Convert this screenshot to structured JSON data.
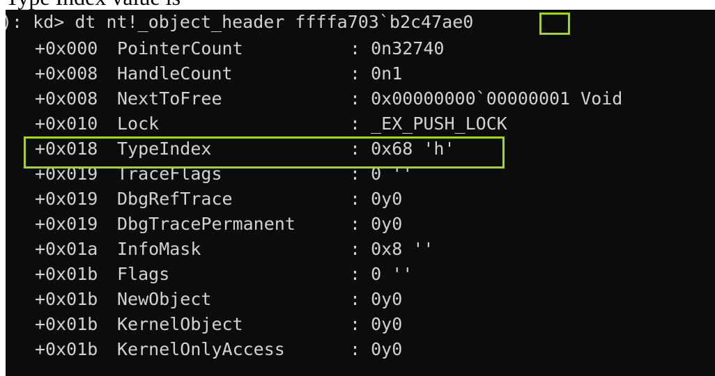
{
  "header_cutoff_text": "Type Index value is",
  "prompt": {
    "text": "): kd> dt nt!_object_header ffffa703`b2c47ae0"
  },
  "fields": [
    {
      "offset": "+0x000",
      "name": "PointerCount",
      "sep": ":",
      "value": "0n32740"
    },
    {
      "offset": "+0x008",
      "name": "HandleCount",
      "sep": ":",
      "value": "0n1"
    },
    {
      "offset": "+0x008",
      "name": "NextToFree",
      "sep": ":",
      "value": "0x00000000`00000001 Void"
    },
    {
      "offset": "+0x010",
      "name": "Lock",
      "sep": ":",
      "value": "_EX_PUSH_LOCK"
    },
    {
      "offset": "+0x018",
      "name": "TypeIndex",
      "sep": ":",
      "value": "0x68 'h'"
    },
    {
      "offset": "+0x019",
      "name": "TraceFlags",
      "sep": ":",
      "value": "0 ''"
    },
    {
      "offset": "+0x019",
      "name": "DbgRefTrace",
      "sep": ":",
      "value": "0y0"
    },
    {
      "offset": "+0x019",
      "name": "DbgTracePermanent",
      "sep": ":",
      "value": "0y0"
    },
    {
      "offset": "+0x01a",
      "name": "InfoMask",
      "sep": ":",
      "value": "0x8 ''"
    },
    {
      "offset": "+0x01b",
      "name": "Flags",
      "sep": ":",
      "value": "0 ''"
    },
    {
      "offset": "+0x01b",
      "name": "NewObject",
      "sep": ":",
      "value": "0y0"
    },
    {
      "offset": "+0x01b",
      "name": "KernelObject",
      "sep": ":",
      "value": "0y0"
    },
    {
      "offset": "+0x01b",
      "name": "KernelOnlyAccess",
      "sep": ":",
      "value": "0y0"
    }
  ],
  "colors": {
    "console_bg": "#0c0c0c",
    "console_text": "#d2d2d2",
    "highlight": "#a6d41d"
  }
}
